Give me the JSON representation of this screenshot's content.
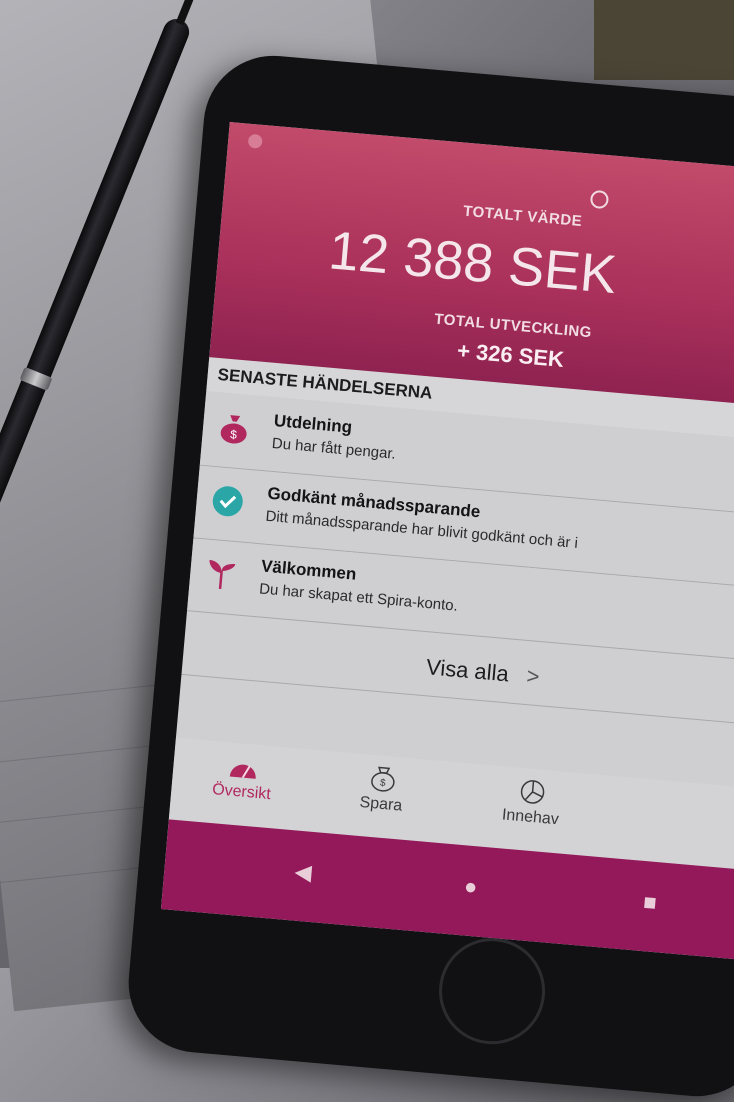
{
  "hero": {
    "total_label": "TOTALT VÄRDE",
    "total_value": "12 388",
    "currency": "SEK",
    "dev_label": "TOTAL UTVECKLING",
    "dev_value": "+ 326 SEK"
  },
  "events": {
    "header": "SENASTE HÄNDELSERNA",
    "items": [
      {
        "title": "Utdelning",
        "desc": "Du har fått pengar.",
        "icon": "money-bag-icon"
      },
      {
        "title": "Godkänt månadssparande",
        "desc": "Ditt månadssparande har blivit godkänt och är i",
        "icon": "check-circle-icon"
      },
      {
        "title": "Välkommen",
        "desc": "Du har skapat ett Spira-konto.",
        "icon": "sprout-icon"
      }
    ],
    "show_all": "Visa alla",
    "show_all_chevron": ">"
  },
  "tabs": [
    {
      "label": "Översikt",
      "icon": "gauge-icon",
      "active": true
    },
    {
      "label": "Spara",
      "icon": "money-bag-icon",
      "active": false
    },
    {
      "label": "Innehav",
      "icon": "pie-chart-icon",
      "active": false
    }
  ],
  "nav": {
    "back": "◀",
    "home": "●",
    "recent": "■"
  },
  "colors": {
    "brand": "#a8305a",
    "accent": "#b0285e",
    "teal": "#2aa6a6",
    "navbar": "#94195a"
  }
}
